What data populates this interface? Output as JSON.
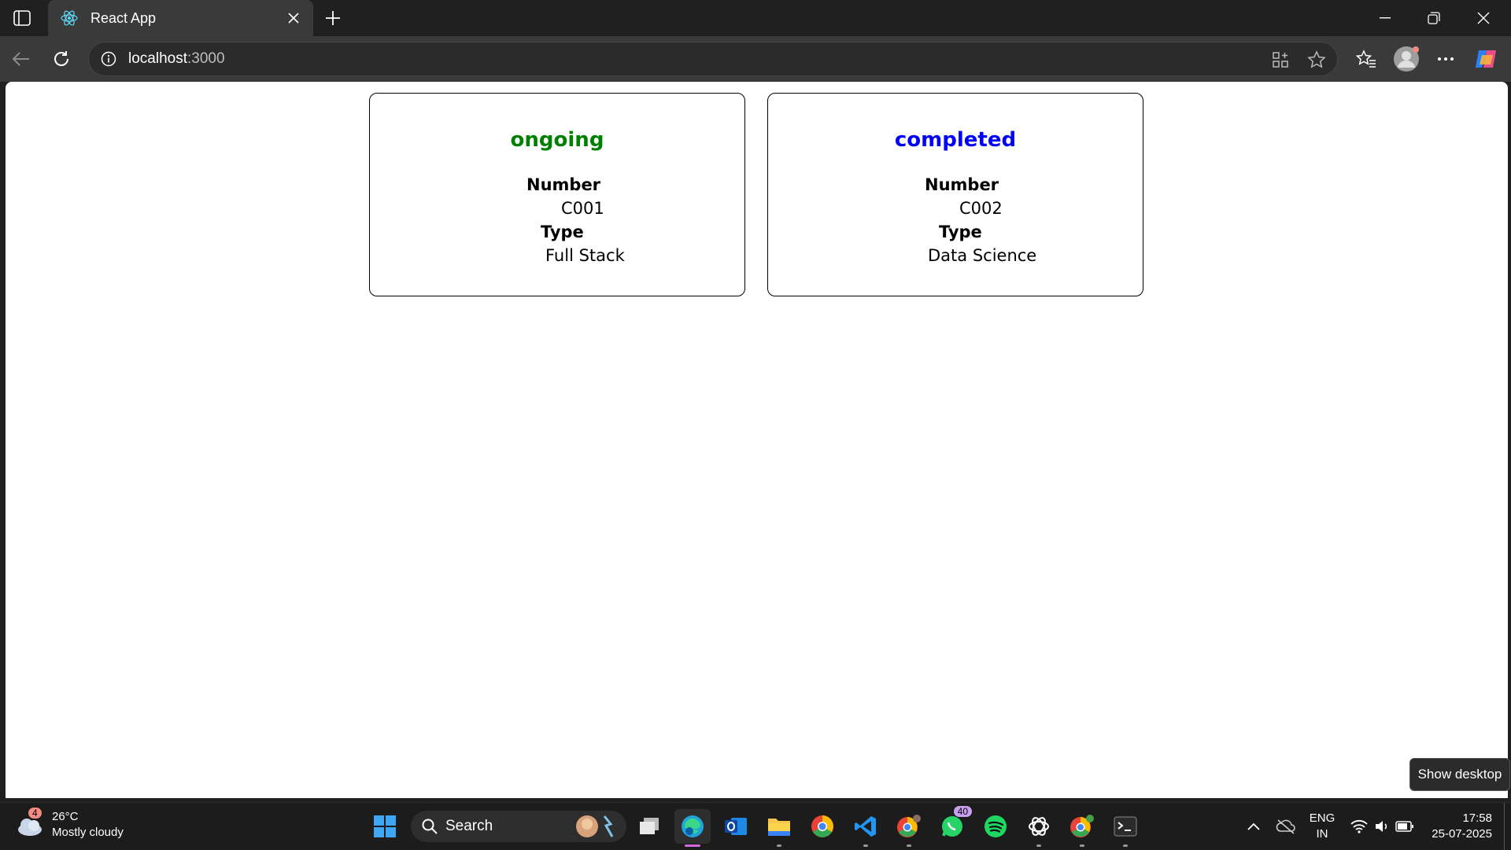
{
  "browser": {
    "tab_title": "React App",
    "url_host": "localhost",
    "url_port": ":3000"
  },
  "cards": [
    {
      "status": "ongoing",
      "status_color": "#008000",
      "number_label": "Number",
      "number": "C001",
      "type_label": "Type",
      "type": "Full Stack"
    },
    {
      "status": "completed",
      "status_color": "#0000ff",
      "number_label": "Number",
      "number": "C002",
      "type_label": "Type",
      "type": "Data Science"
    }
  ],
  "taskbar": {
    "weather_temp": "26°C",
    "weather_desc": "Mostly cloudy",
    "weather_badge": "4",
    "search_label": "Search",
    "whatsapp_badge": "40",
    "language": "ENG",
    "region": "IN",
    "time": "17:58",
    "date": "25-07-2025",
    "show_desktop_tooltip": "Show desktop"
  }
}
